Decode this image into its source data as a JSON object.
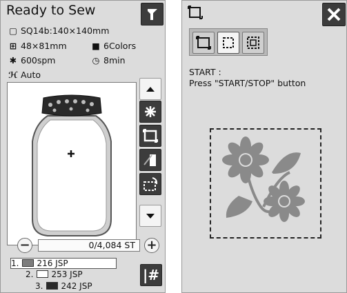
{
  "left_panel": {
    "title": "Ready to Sew",
    "hoop": "SQ14b:140×140mm",
    "size": "48×81mm",
    "colors": "6Colors",
    "speed": "600spm",
    "time": "8min",
    "presser": "Auto",
    "stitch_count": "0/4,084 ST",
    "color_list": [
      {
        "index": "1.",
        "label": "216 JSP",
        "swatch": "#7d7d7d"
      },
      {
        "index": "2.",
        "label": "253 JSP",
        "swatch": "#ffffff"
      },
      {
        "index": "3.",
        "label": "242 JSP",
        "swatch": "#2a2a2a"
      }
    ],
    "hash_label": "|#",
    "icons": {
      "hoop": "hoop-icon",
      "size": "design-size-icon",
      "colors": "thread-spool-icon",
      "speed": "speed-icon",
      "time": "clock-icon",
      "presser": "presser-foot-icon"
    }
  },
  "right_panel": {
    "instruction_title": "START :",
    "instruction_text": "Press \"START/STOP\" button"
  },
  "colors": {
    "panel_bg": "#dcdcdc",
    "dark_button": "#3c3c3c",
    "flower_gray": "#8a8a8a"
  }
}
